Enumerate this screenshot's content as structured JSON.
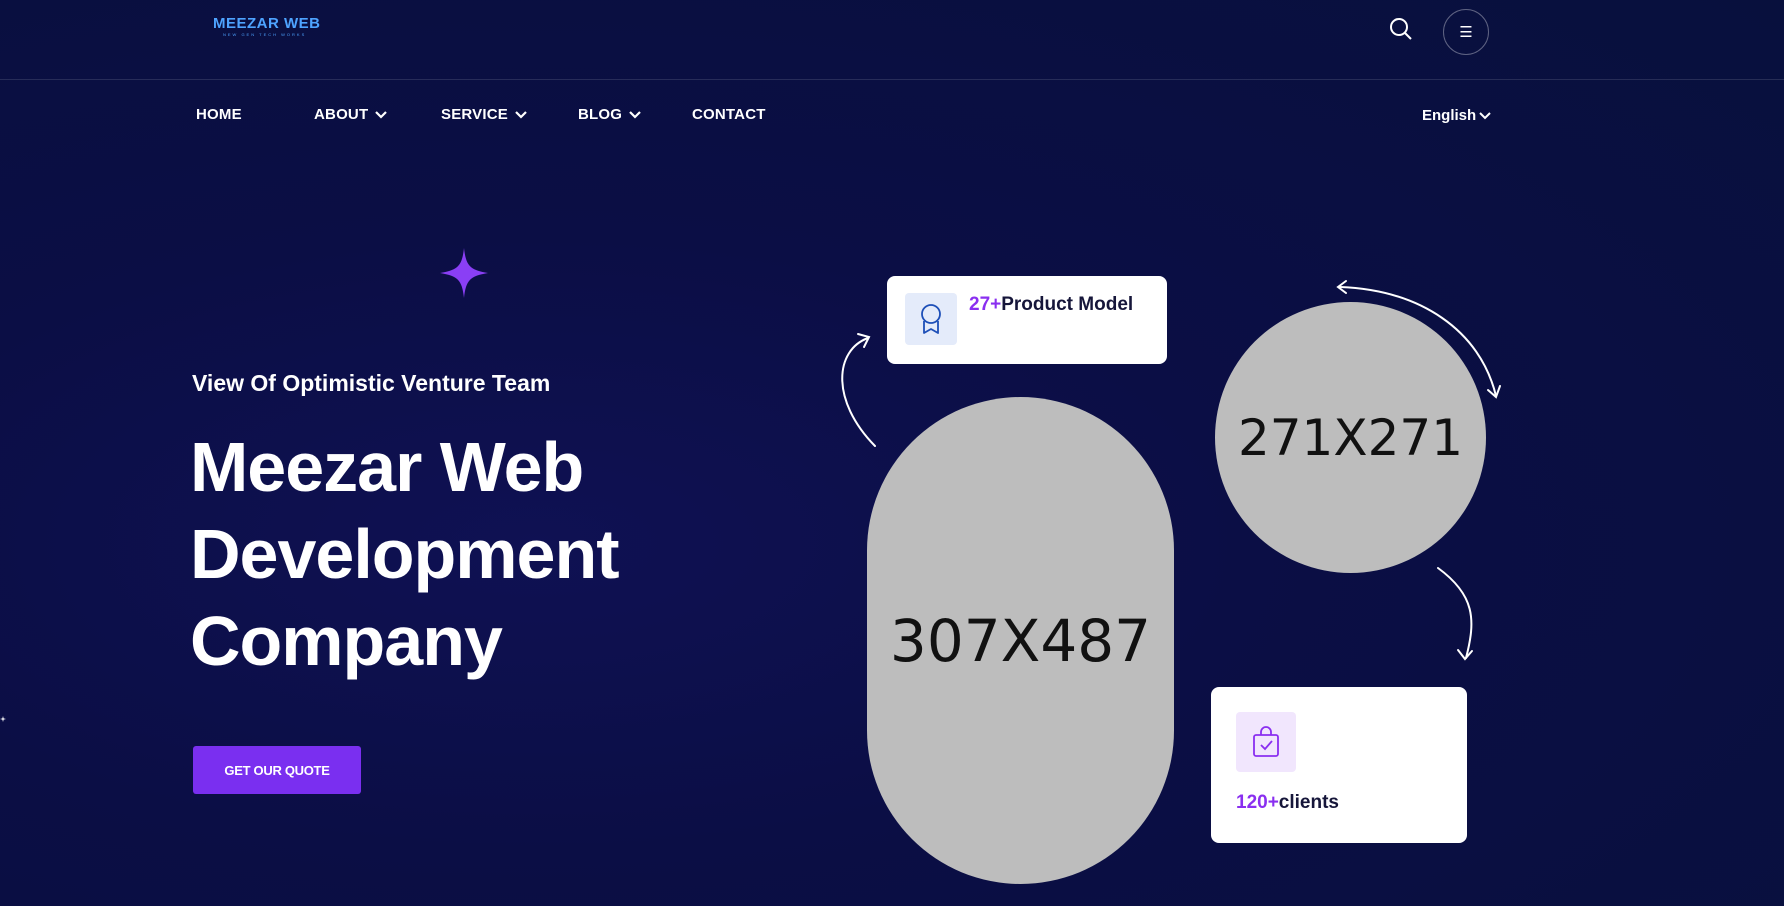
{
  "brand": {
    "logo_main": "MEEZAR WEB",
    "logo_sub": "NEW GEN TECH WORKS"
  },
  "header": {
    "search_icon": "search-icon",
    "menu_icon": "hamburger-icon",
    "menu_glyph": "☰"
  },
  "nav": {
    "items": [
      {
        "label": "HOME",
        "has_dropdown": false
      },
      {
        "label": "ABOUT",
        "has_dropdown": true
      },
      {
        "label": "SERVICE",
        "has_dropdown": true
      },
      {
        "label": "BLOG",
        "has_dropdown": true
      },
      {
        "label": "CONTACT",
        "has_dropdown": false
      }
    ],
    "language": "English"
  },
  "hero": {
    "tagline": "View Of Optimistic Venture Team",
    "headline_lines": [
      "Meezar Web",
      "Development",
      "Company"
    ],
    "cta_label": "GET OUR QUOTE"
  },
  "stats": {
    "products": {
      "number": "27+",
      "label": "Product Model",
      "icon": "award-icon"
    },
    "clients": {
      "number": "120+",
      "label": "clients",
      "icon": "shopping-bag-check-icon"
    }
  },
  "placeholders": {
    "oval": "307X487",
    "circle": "271X271"
  },
  "colors": {
    "accent": "#7a2ff0",
    "background": "#0b0e45",
    "logo": "#4ea3ff"
  }
}
